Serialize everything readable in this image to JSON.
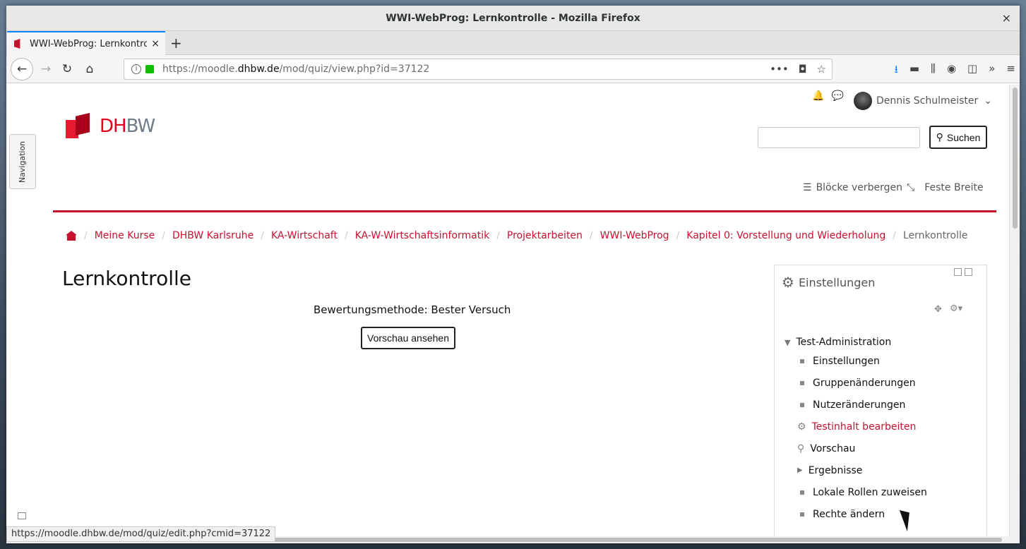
{
  "window": {
    "title": "WWI-WebProg: Lernkontrolle - Mozilla Firefox",
    "close": "×"
  },
  "tabs": [
    {
      "title": "WWI-WebProg: Lernkontrolle",
      "close": "×"
    }
  ],
  "new_tab": "+",
  "nav": {
    "back": "←",
    "forward": "→",
    "reload": "↻",
    "home": "⌂"
  },
  "urlbar": {
    "prefix": "https://moodle.",
    "domain": "dhbw.de",
    "path": "/mod/quiz/view.php?id=37122",
    "icons": [
      "•••",
      "◘",
      "☆"
    ]
  },
  "toolbar_icons": [
    "⭳",
    "▬",
    "⫼",
    "◉",
    "◫",
    "»",
    "≡"
  ],
  "moodle": {
    "navigation_tab": "Navigation",
    "logo_dh": "DH",
    "logo_bw": "BW",
    "user_name": "Dennis Schulmeister",
    "user_caret": "⌄",
    "search_button": "Suchen",
    "hide_blocks": "Blöcke verbergen",
    "fixed_width": "Feste Breite",
    "breadcrumb": [
      "Meine Kurse",
      "DHBW Karlsruhe",
      "KA-Wirtschaft",
      "KA-W-Wirtschaftsinformatik",
      "Projektarbeiten",
      "WWI-WebProg",
      "Kapitel 0: Vorstellung und Wiederholung"
    ],
    "breadcrumb_current": "Lernkontrolle",
    "page_title": "Lernkontrolle",
    "grading_method": "Bewertungsmethode: Bester Versuch",
    "preview_button": "Vorschau ansehen",
    "settings_block": {
      "title": "Einstellungen",
      "root": "Test-Administration",
      "items": [
        {
          "label": "Einstellungen",
          "icon": "bullet"
        },
        {
          "label": "Gruppenänderungen",
          "icon": "bullet"
        },
        {
          "label": "Nutzeränderungen",
          "icon": "bullet"
        },
        {
          "label": "Testinhalt bearbeiten",
          "icon": "gear"
        },
        {
          "label": "Vorschau",
          "icon": "search"
        },
        {
          "label": "Ergebnisse",
          "icon": "triangle"
        },
        {
          "label": "Lokale Rollen zuweisen",
          "icon": "bullet"
        },
        {
          "label": "Rechte ändern",
          "icon": "bullet"
        }
      ]
    }
  },
  "status_url": "https://moodle.dhbw.de/mod/quiz/edit.php?cmid=37122",
  "colors": {
    "accent": "#c4122f",
    "firefox_blue": "#0a84ff"
  }
}
